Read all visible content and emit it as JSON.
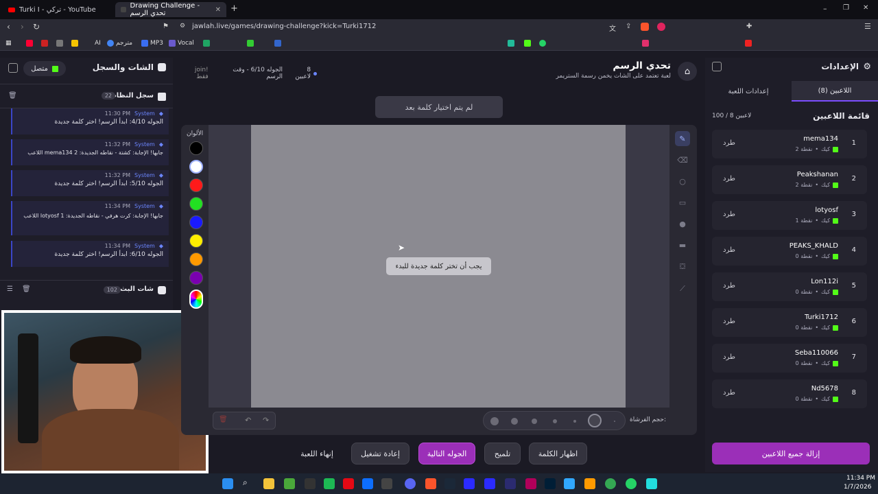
{
  "browser": {
    "tabs": [
      {
        "title": "Turki I - تركي - YouTube"
      },
      {
        "title": "Drawing Challenge - تحدي الرسم"
      }
    ],
    "url": "jawlah.live/games/drawing-challenge?kick=Turki1712",
    "bookmarks": [
      "AI",
      "مترجم",
      "MP3",
      "Vocal"
    ]
  },
  "left": {
    "title": "الشات والسجل",
    "status": "متصل",
    "system_log": {
      "title": "سجل النظام",
      "count": "22"
    },
    "messages": [
      {
        "time": "11:30 PM",
        "sender": "System",
        "text": "الجوله 4/10: ابدأ الرسم! اختر كلمة جديدة"
      },
      {
        "time": "11:32 PM",
        "sender": "System",
        "text": "اللاعب mema134 جابها! الإجابة: كشتة - نقاطه الجديدة: 2"
      },
      {
        "time": "11:32 PM",
        "sender": "System",
        "text": "الجوله 5/10: ابدأ الرسم! اختر كلمة جديدة"
      },
      {
        "time": "11:34 PM",
        "sender": "System",
        "text": "اللاعب lotyosf جابها! الإجابة: كرت هرفي - نقاطه الجديدة: 1"
      },
      {
        "time": "11:34 PM",
        "sender": "System",
        "text": "الجوله 6/10: ابدأ الرسم! اختر كلمة جديدة"
      }
    ],
    "stream_chat": {
      "title": "شات البث",
      "count": "102"
    }
  },
  "game": {
    "title": "تحدي الرسم",
    "subtitle": "لعبة تعتمد على الشات يخمن رسمة الستريمر",
    "players_count": "8 لاعبين",
    "round_info": "الجوله 6/10 - وقت الرسم",
    "join_hint": "!join فقط",
    "word_status": "لم يتم اختيار كلمة بعد",
    "canvas_prompt": "يجب أن تختر كلمة جديدة للبدء",
    "colors_label": "الألوان",
    "palette": [
      "#000000",
      "#ffffff",
      "#ff1a1a",
      "#22e022",
      "#1a1aff",
      "#ffee00",
      "#ff9900",
      "#7a00b0"
    ],
    "brush_label": "حجم الفرشاة:",
    "buttons": {
      "reveal": "اظهار الكلمة",
      "hint": "تلميح",
      "next": "الجوله التالية",
      "restart": "إعادة تشغيل",
      "end": "إنهاء اللعبة"
    }
  },
  "right": {
    "title": "الإعدادات",
    "tab_players": "اللاعبين (8)",
    "tab_settings": "إعدادات اللعبة",
    "list_title": "قائمة اللاعبين",
    "capacity": "100 / 8 لاعبين",
    "kick_label": "طرد",
    "platform": "كيك",
    "players": [
      {
        "rank": "1",
        "name": "mema134",
        "points": "2 نقطة"
      },
      {
        "rank": "2",
        "name": "Peakshanan",
        "points": "2 نقطة"
      },
      {
        "rank": "3",
        "name": "lotyosf",
        "points": "1 نقطة"
      },
      {
        "rank": "4",
        "name": "PEAKS_KHALD",
        "points": "0 نقطة"
      },
      {
        "rank": "5",
        "name": "Lon112i",
        "points": "0 نقطة"
      },
      {
        "rank": "6",
        "name": "Turki1712",
        "points": "0 نقطة"
      },
      {
        "rank": "7",
        "name": "Seba110066",
        "points": "0 نقطة"
      },
      {
        "rank": "8",
        "name": "Nd5678",
        "points": "0 نقطة"
      }
    ],
    "remove_all": "إزالة جميع اللاعبين"
  },
  "taskbar": {
    "time": "11:34 PM",
    "date": "1/7/2026"
  }
}
